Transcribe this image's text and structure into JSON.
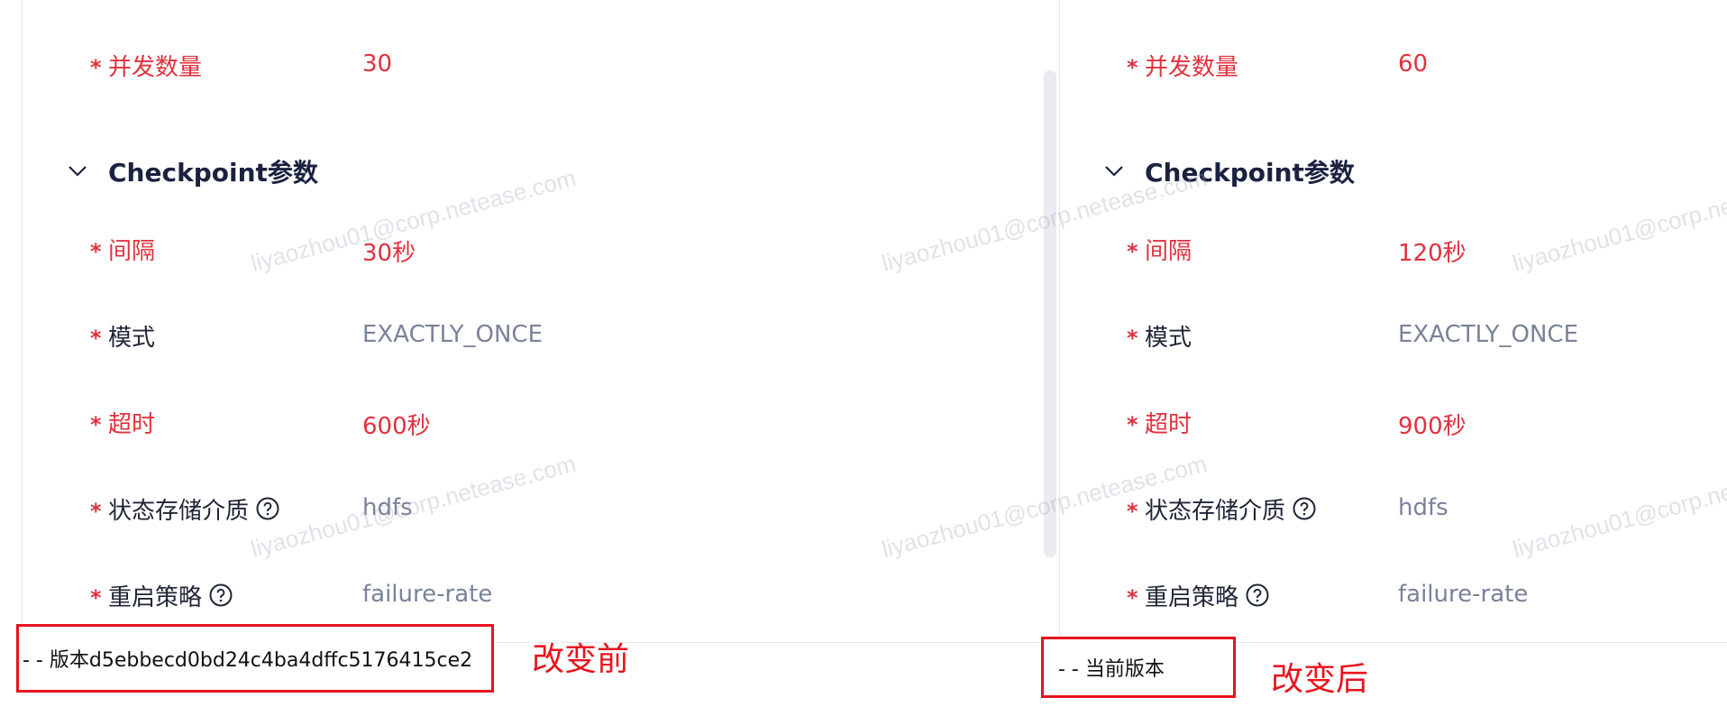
{
  "watermark_text": "liyaozhou01@corp.netease.com",
  "before": {
    "concurrency": {
      "label": "并发数量",
      "value": "30"
    },
    "section_title": "Checkpoint参数",
    "interval": {
      "label": "间隔",
      "value": "30秒"
    },
    "mode": {
      "label": "模式",
      "value": "EXACTLY_ONCE"
    },
    "timeout": {
      "label": "超时",
      "value": "600秒"
    },
    "state_backend": {
      "label": "状态存储介质",
      "value": "hdfs"
    },
    "restart": {
      "label": "重启策略",
      "value": "failure-rate"
    },
    "version_label": "- - 版本d5ebbecd0bd24c4ba4dffc5176415ce2",
    "annotation": "改变前"
  },
  "after": {
    "concurrency": {
      "label": "并发数量",
      "value": "60"
    },
    "section_title": "Checkpoint参数",
    "interval": {
      "label": "间隔",
      "value": "120秒"
    },
    "mode": {
      "label": "模式",
      "value": "EXACTLY_ONCE"
    },
    "timeout": {
      "label": "超时",
      "value": "900秒"
    },
    "state_backend": {
      "label": "状态存储介质",
      "value": "hdfs"
    },
    "restart": {
      "label": "重启策略",
      "value": "failure-rate"
    },
    "version_label": "- - 当前版本",
    "annotation": "改变后"
  },
  "colors": {
    "changed": "#e0323f",
    "label": "#1f2536",
    "value": "#7a8299",
    "annotation": "#e8141e"
  },
  "icons": {
    "help": "question-circle-icon",
    "section_toggle": "chevron-down-icon"
  }
}
